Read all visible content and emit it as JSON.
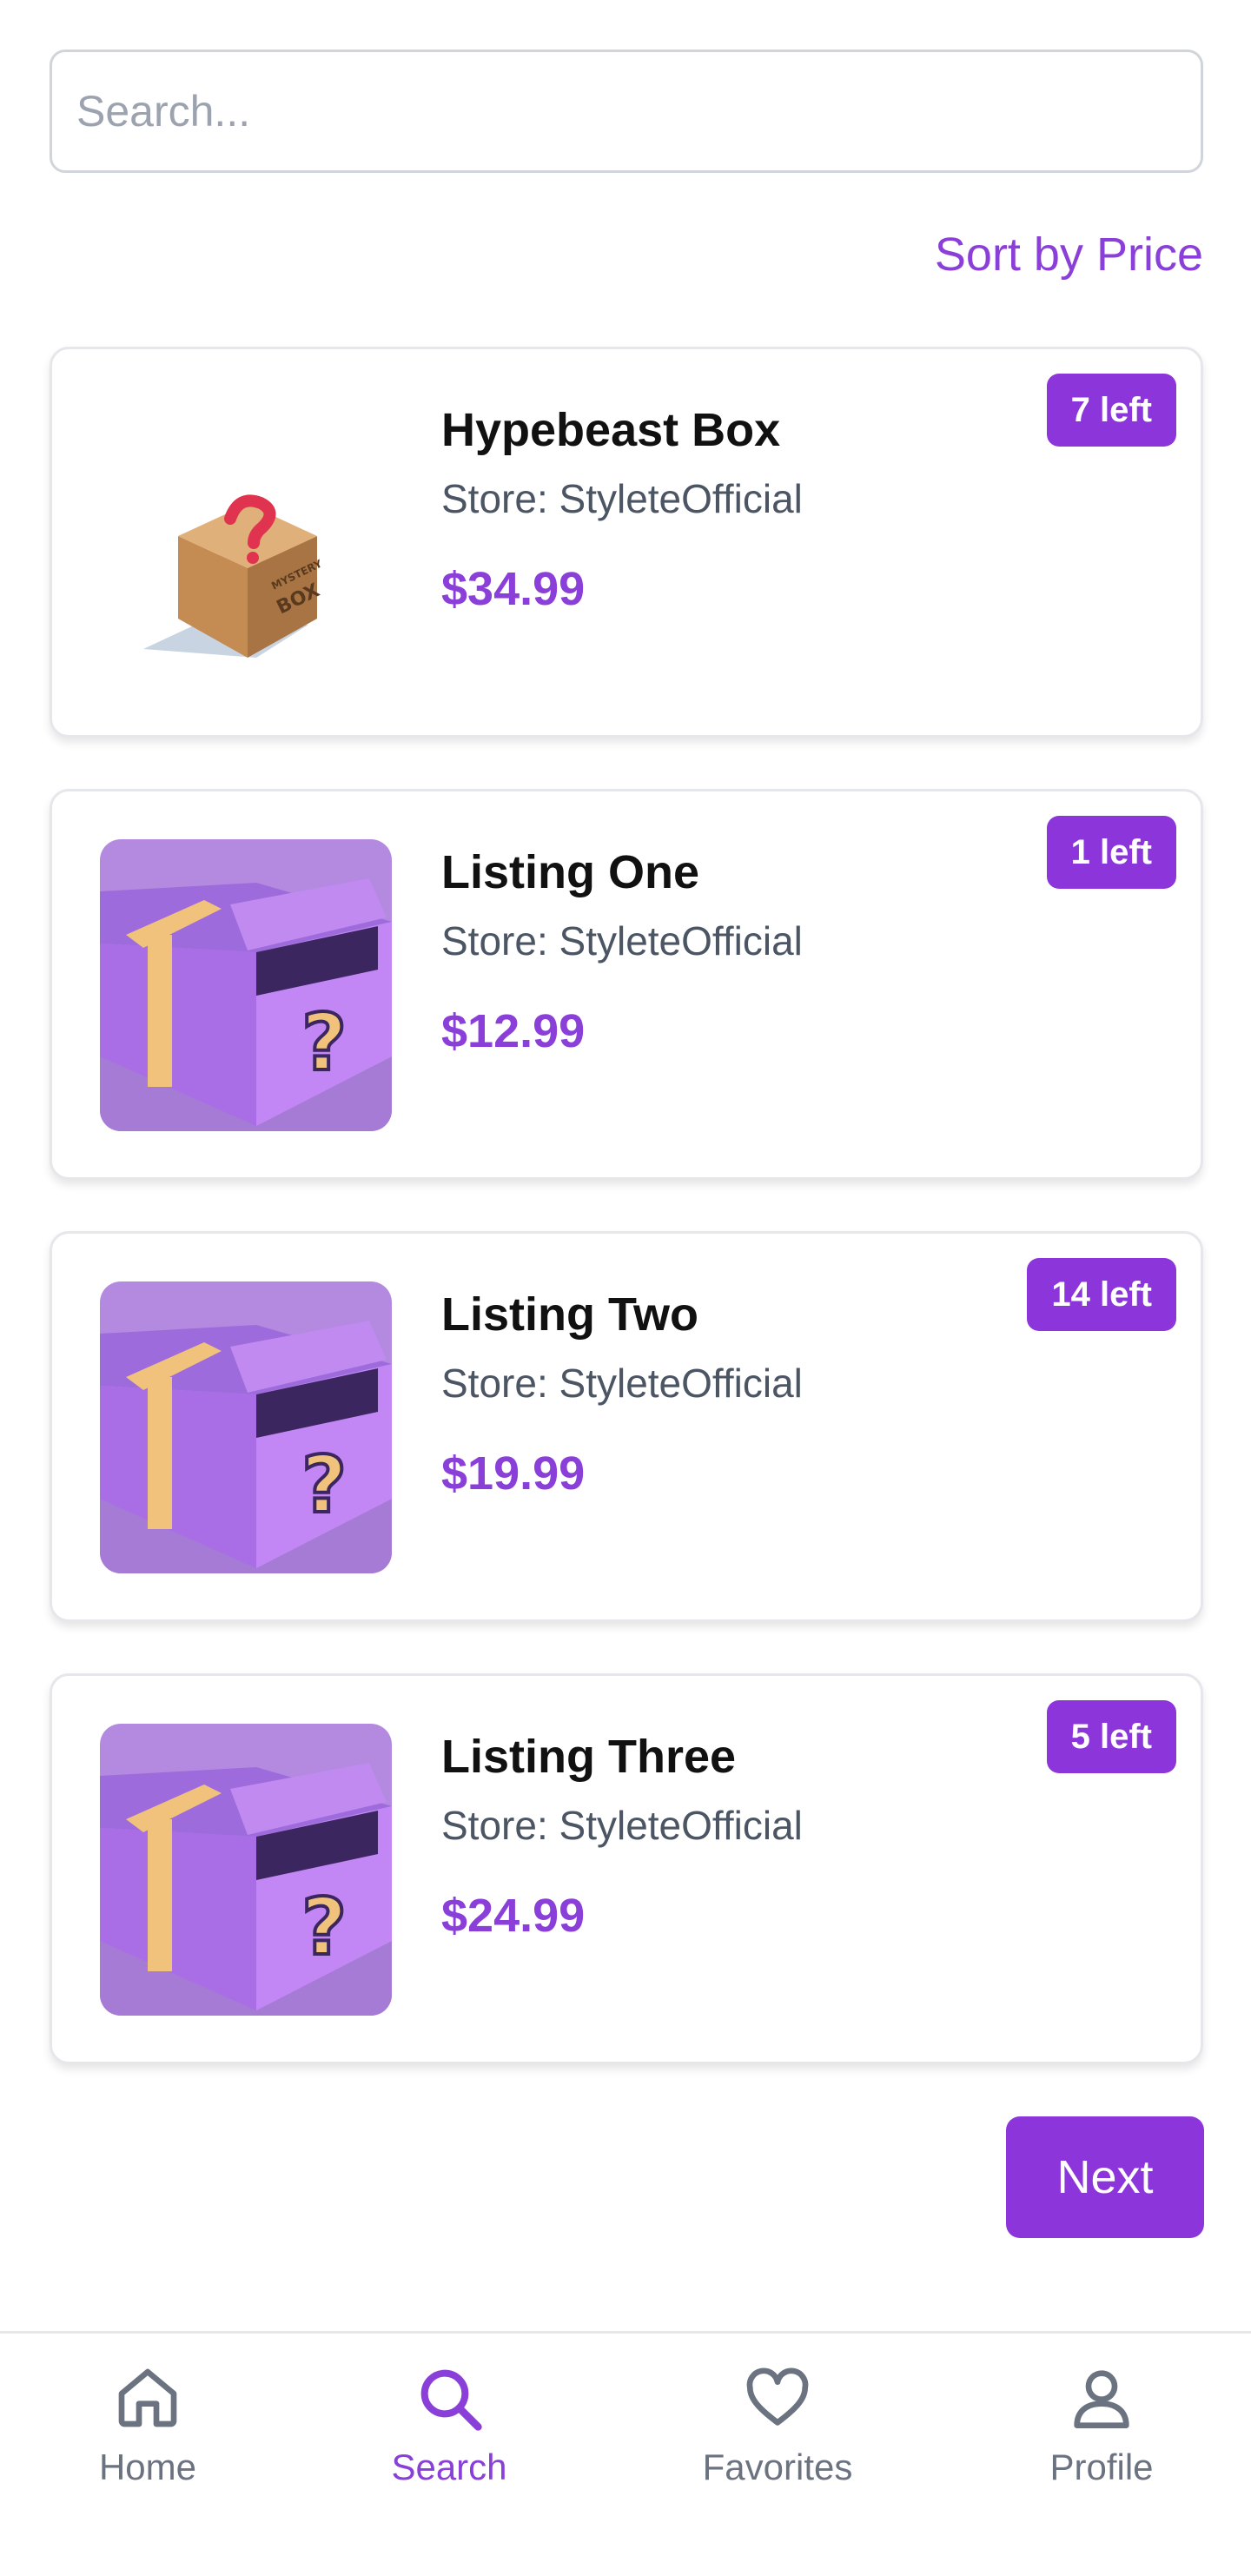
{
  "search": {
    "placeholder": "Search...",
    "value": ""
  },
  "sort": {
    "label": "Sort by Price"
  },
  "listings": [
    {
      "title": "Hypebeast Box",
      "store": "Store: StyleteOfficial",
      "price": "$34.99",
      "stock": "7 left",
      "image": "mystery-box-cardboard"
    },
    {
      "title": "Listing One",
      "store": "Store: StyleteOfficial",
      "price": "$12.99",
      "stock": "1 left",
      "image": "purple-mystery-box"
    },
    {
      "title": "Listing Two",
      "store": "Store: StyleteOfficial",
      "price": "$19.99",
      "stock": "14 left",
      "image": "purple-mystery-box"
    },
    {
      "title": "Listing Three",
      "store": "Store: StyleteOfficial",
      "price": "$24.99",
      "stock": "5 left",
      "image": "purple-mystery-box"
    }
  ],
  "pagination": {
    "next_label": "Next"
  },
  "nav": {
    "items": [
      {
        "label": "Home",
        "icon": "home-icon",
        "active": false
      },
      {
        "label": "Search",
        "icon": "search-icon",
        "active": true
      },
      {
        "label": "Favorites",
        "icon": "heart-icon",
        "active": false
      },
      {
        "label": "Profile",
        "icon": "user-icon",
        "active": false
      }
    ]
  },
  "colors": {
    "accent": "#8b35db",
    "accent_text": "#8b3fd9",
    "muted": "#6b7280",
    "box_purple": "#b57be8",
    "box_tape": "#f0c27b"
  }
}
